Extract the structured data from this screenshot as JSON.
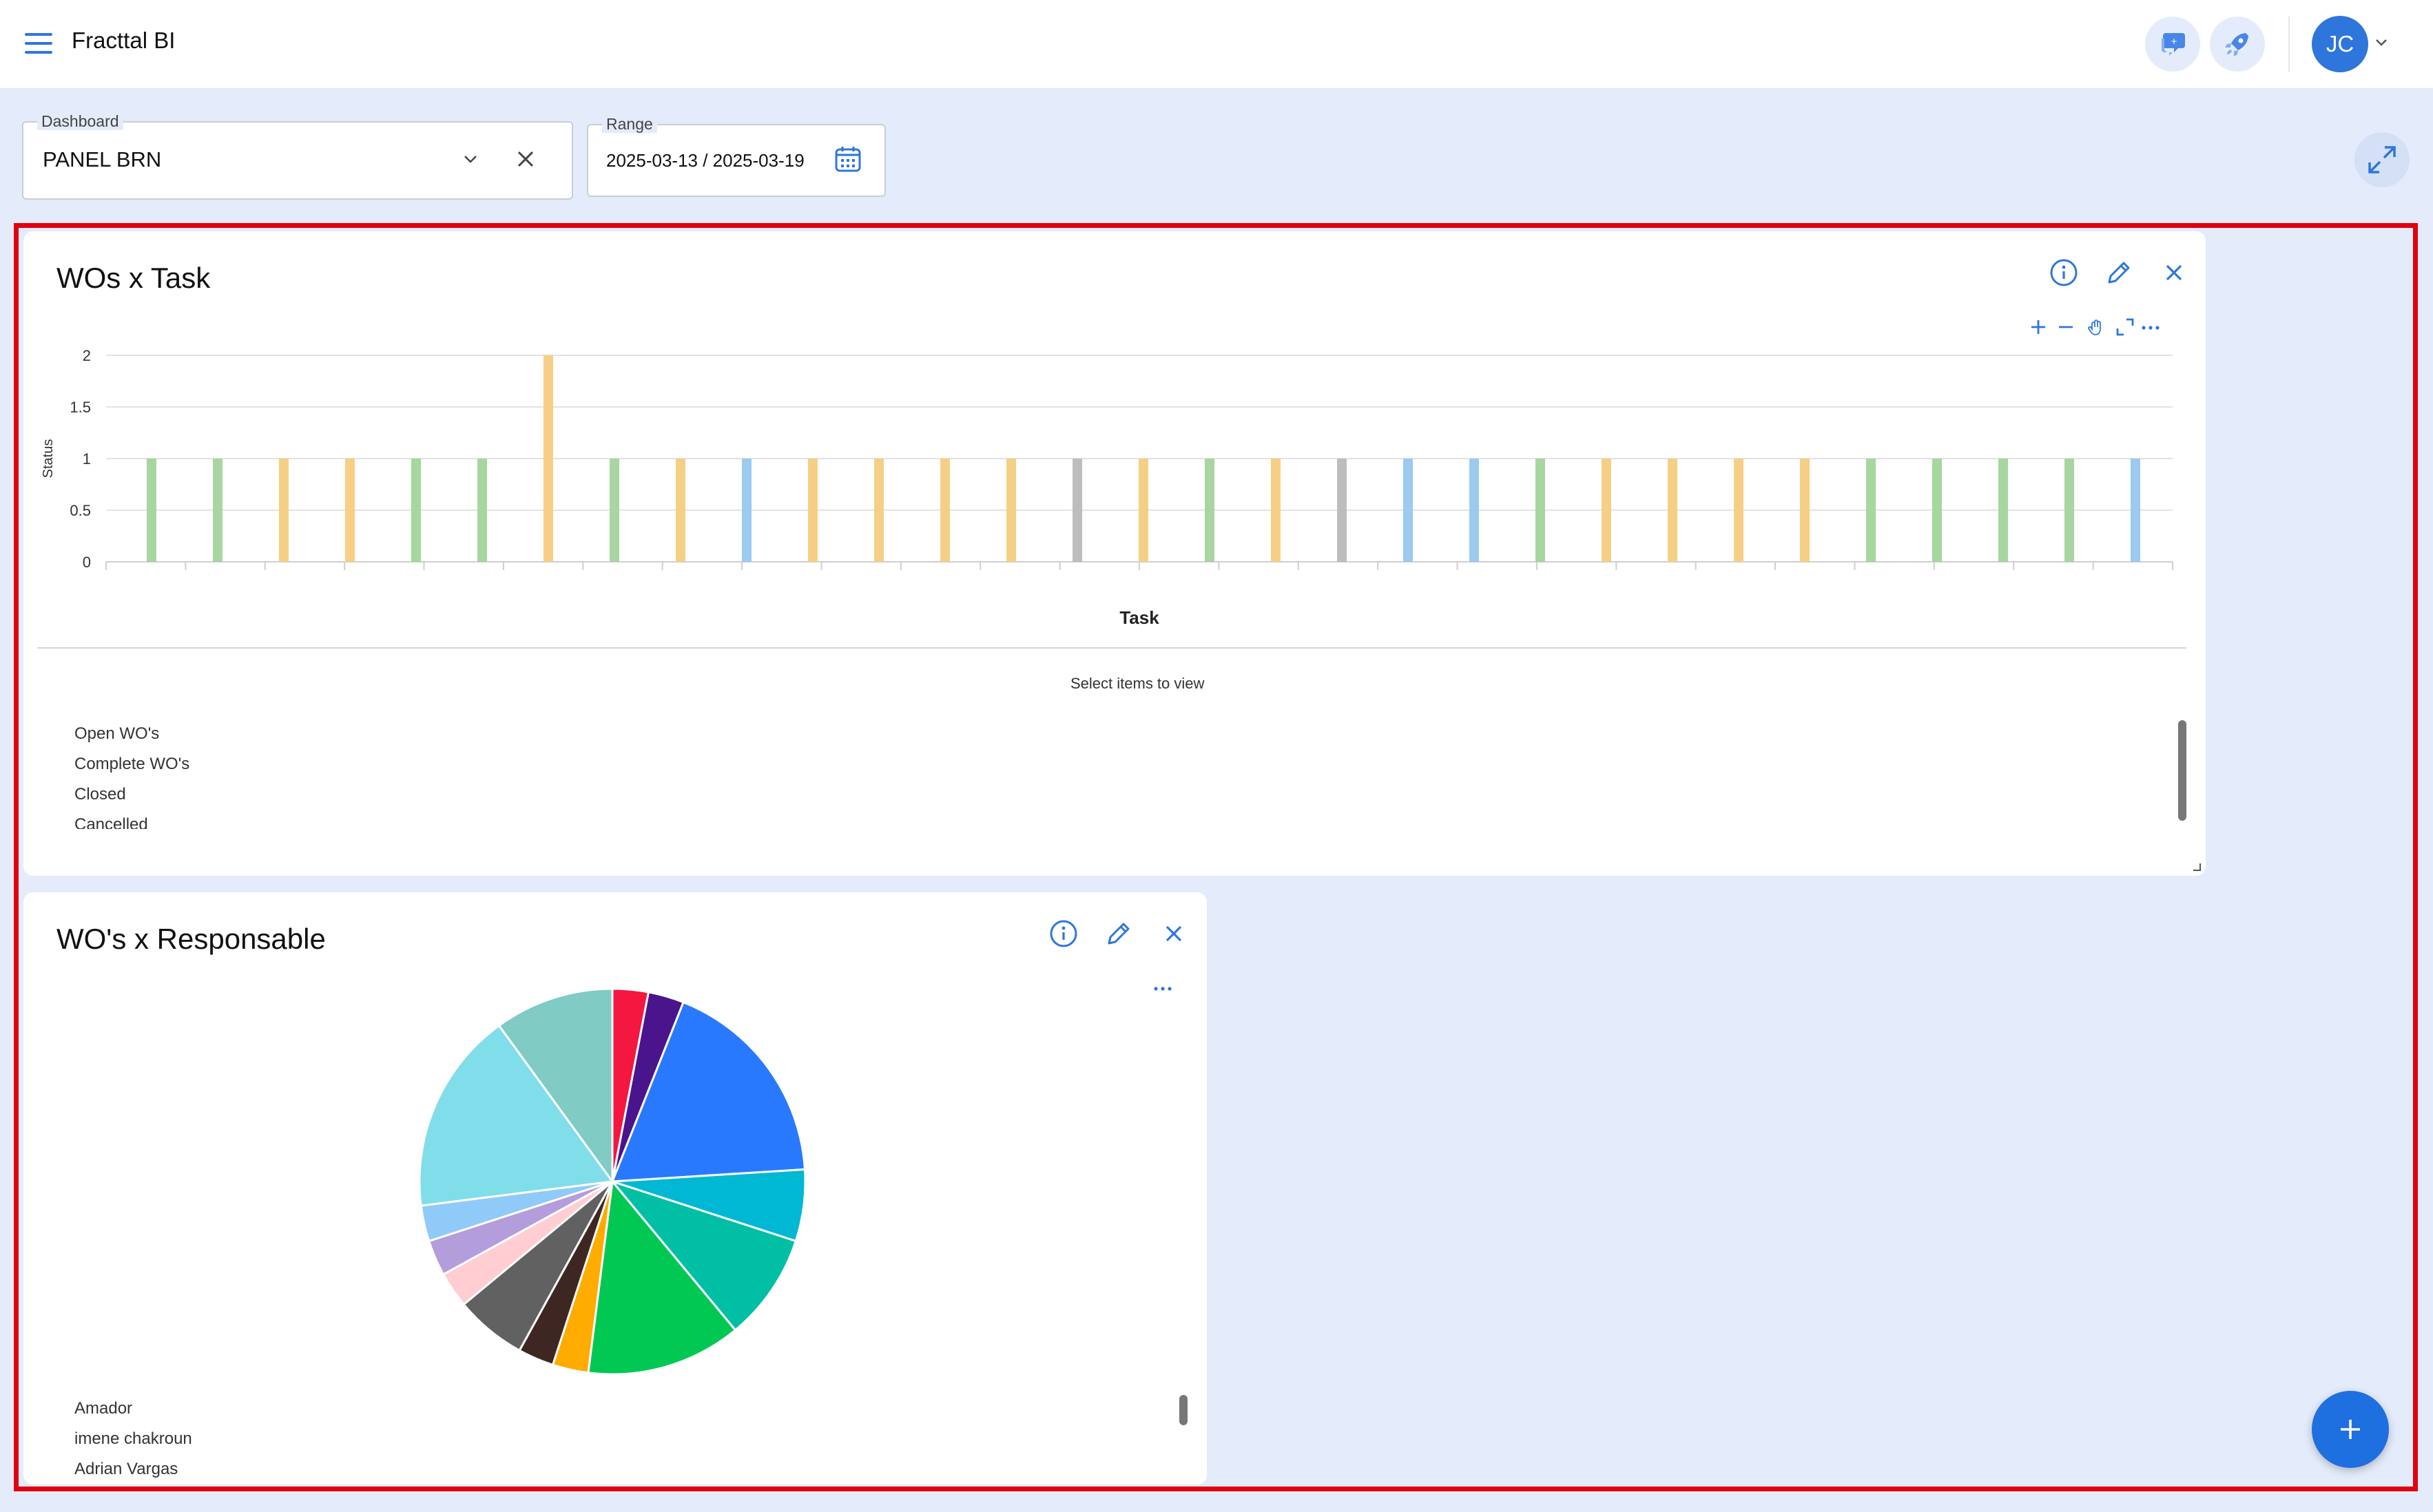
{
  "app": {
    "title": "Fracttal BI"
  },
  "header": {
    "icons": [
      "menu-icon",
      "chat-icon",
      "rocket-icon",
      "chevron-down-icon"
    ],
    "user_initials": "JC"
  },
  "filters": {
    "dashboard": {
      "label": "Dashboard",
      "value": "PANEL BRN"
    },
    "range": {
      "label": "Range",
      "value": "2025-03-13 / 2025-03-19"
    }
  },
  "colors": {
    "open": "#f6cf86",
    "complete": "#a7d6a0",
    "closed": "#9ccaf1",
    "cancelled": "#bdbdbd",
    "accent": "#1e6fe0",
    "highlight": "#e0000f"
  },
  "widgets": {
    "wos_task": {
      "title": "WOs x Task",
      "legend_title": "Select items to view",
      "legend": [
        "Open WO's",
        "Complete WO's",
        "Closed",
        "Cancelled"
      ],
      "chart_data": {
        "type": "bar",
        "xlabel": "Task",
        "ylabel": "Status",
        "ylim": [
          0,
          2
        ],
        "yticks": [
          "2",
          "1.5",
          "1",
          "0.5",
          "0"
        ],
        "grid": true,
        "series_order": [
          "Open WO's",
          "Complete WO's",
          "Closed",
          "Cancelled"
        ],
        "bars": [
          {
            "series": "Complete WO's",
            "value": 1
          },
          {
            "series": "Complete WO's",
            "value": 1
          },
          {
            "series": "Open WO's",
            "value": 1
          },
          {
            "series": "Open WO's",
            "value": 1
          },
          {
            "series": "Complete WO's",
            "value": 1
          },
          {
            "series": "Complete WO's",
            "value": 1
          },
          {
            "series": "Open WO's",
            "value": 2
          },
          {
            "series": "Complete WO's",
            "value": 1
          },
          {
            "series": "Open WO's",
            "value": 1
          },
          {
            "series": "Closed",
            "value": 1
          },
          {
            "series": "Open WO's",
            "value": 1
          },
          {
            "series": "Open WO's",
            "value": 1
          },
          {
            "series": "Open WO's",
            "value": 1
          },
          {
            "series": "Open WO's",
            "value": 1
          },
          {
            "series": "Cancelled",
            "value": 1
          },
          {
            "series": "Open WO's",
            "value": 1
          },
          {
            "series": "Complete WO's",
            "value": 1
          },
          {
            "series": "Open WO's",
            "value": 1
          },
          {
            "series": "Cancelled",
            "value": 1
          },
          {
            "series": "Closed",
            "value": 1
          },
          {
            "series": "Closed",
            "value": 1
          },
          {
            "series": "Complete WO's",
            "value": 1
          },
          {
            "series": "Open WO's",
            "value": 1
          },
          {
            "series": "Open WO's",
            "value": 1
          },
          {
            "series": "Open WO's",
            "value": 1
          },
          {
            "series": "Open WO's",
            "value": 1
          },
          {
            "series": "Complete WO's",
            "value": 1
          },
          {
            "series": "Complete WO's",
            "value": 1
          },
          {
            "series": "Complete WO's",
            "value": 1
          },
          {
            "series": "Complete WO's",
            "value": 1
          },
          {
            "series": "Closed",
            "value": 1
          }
        ]
      }
    },
    "wos_responsable": {
      "title": "WO's x Responsable",
      "legend": [
        "Amador",
        "imene chakroun",
        "Adrian Vargas"
      ],
      "chart_data": {
        "type": "pie",
        "slices": [
          {
            "color": "#f4173f",
            "value": 3
          },
          {
            "color": "#4a148c",
            "value": 3
          },
          {
            "color": "#2979ff",
            "value": 18
          },
          {
            "color": "#00b8d4",
            "value": 6
          },
          {
            "color": "#00bfa5",
            "value": 9
          },
          {
            "color": "#00c853",
            "value": 13
          },
          {
            "color": "#ffab00",
            "value": 3
          },
          {
            "color": "#3e2723",
            "value": 3
          },
          {
            "color": "#616161",
            "value": 6
          },
          {
            "color": "#ffcdd2",
            "value": 3
          },
          {
            "color": "#b39ddb",
            "value": 3
          },
          {
            "color": "#90caf9",
            "value": 3
          },
          {
            "color": "#80deea",
            "value": 17
          },
          {
            "color": "#80cbc4",
            "value": 10
          }
        ]
      }
    }
  }
}
